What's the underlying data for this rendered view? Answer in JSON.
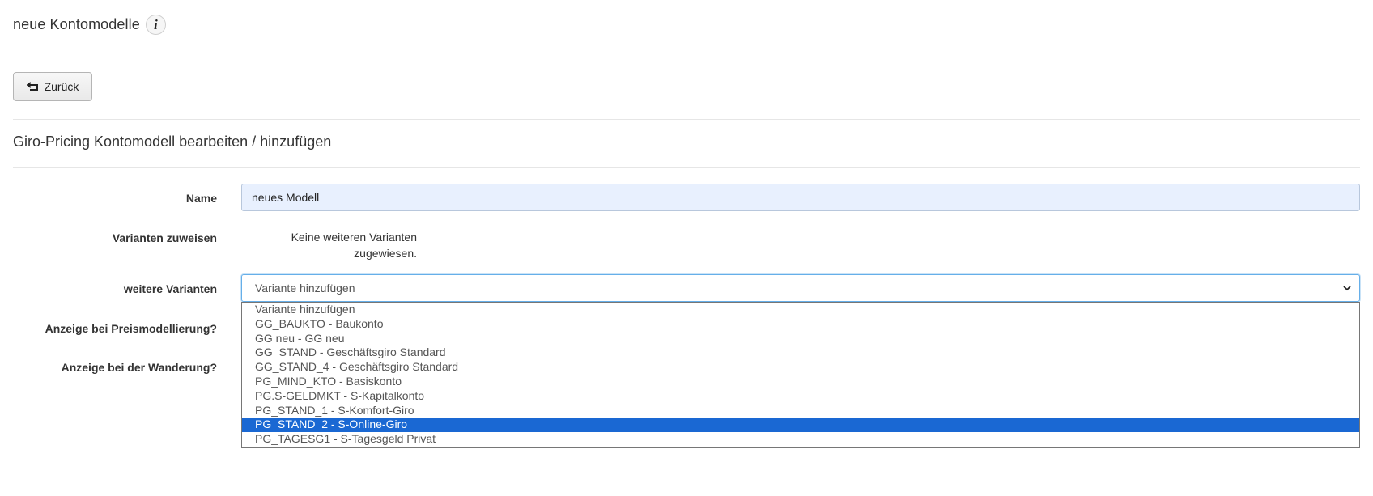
{
  "header": {
    "title": "neue Kontomodelle",
    "info_icon": "info-icon"
  },
  "toolbar": {
    "back_label": "Zurück",
    "back_icon": "return-arrow-icon"
  },
  "section": {
    "title": "Giro-Pricing Kontomodell bearbeiten / hinzufügen"
  },
  "form": {
    "name_label": "Name",
    "name_value": "neues Modell",
    "variants_assign_label": "Varianten zuweisen",
    "variants_note_line1": "Keine weiteren Varianten",
    "variants_note_line2": "zugewiesen.",
    "more_variants_label": "weitere Varianten",
    "more_variants_selected": "Variante hinzufügen",
    "price_modelling_label": "Anzeige bei Preismodellierung?",
    "migration_label": "Anzeige bei der Wanderung?"
  },
  "dropdown": {
    "options": [
      "Variante hinzufügen",
      "GG_BAUKTO - Baukonto",
      "GG neu - GG neu",
      "GG_STAND - Geschäftsgiro Standard",
      "GG_STAND_4 - Geschäftsgiro Standard",
      "PG_MIND_KTO - Basiskonto",
      "PG.S-GELDMKT - S-Kapitalkonto",
      "PG_STAND_1 - S-Komfort-Giro",
      "PG_STAND_2 - S-Online-Giro",
      "PG_TAGESG1 - S-Tagesgeld Privat"
    ],
    "highlighted": "PG_STAND_2 - S-Online-Giro"
  },
  "colors": {
    "highlight": "#1a68d3",
    "input_fill": "#e8f0fe",
    "focus_border": "#66afe9"
  }
}
